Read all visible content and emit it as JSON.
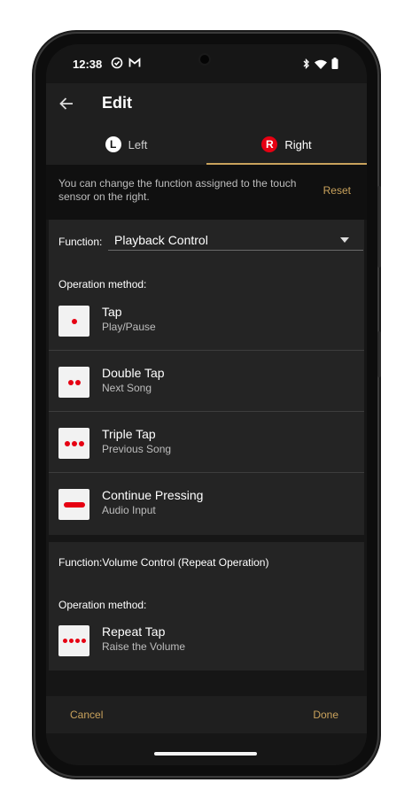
{
  "status": {
    "time": "12:38"
  },
  "appbar": {
    "title": "Edit"
  },
  "tabs": [
    {
      "badge": "L",
      "label": "Left"
    },
    {
      "badge": "R",
      "label": "Right"
    }
  ],
  "info": {
    "text": "You can change the function assigned to the touch sensor on the right.",
    "reset_label": "Reset"
  },
  "function1": {
    "label": "Function:",
    "value": "Playback Control",
    "operation_label": "Operation method:",
    "methods": [
      {
        "title": "Tap",
        "subtitle": "Play/Pause"
      },
      {
        "title": "Double Tap",
        "subtitle": "Next Song"
      },
      {
        "title": "Triple Tap",
        "subtitle": "Previous Song"
      },
      {
        "title": "Continue Pressing",
        "subtitle": "Audio Input"
      }
    ]
  },
  "function2": {
    "label": "Function:Volume Control (Repeat Operation)",
    "operation_label": "Operation method:",
    "methods": [
      {
        "title": "Repeat Tap",
        "subtitle": "Raise the Volume"
      }
    ]
  },
  "bottom": {
    "cancel_label": "Cancel",
    "done_label": "Done"
  },
  "colors": {
    "accent": "#c9a25c",
    "red": "#e60012",
    "background": "#161616",
    "card": "#242424"
  }
}
